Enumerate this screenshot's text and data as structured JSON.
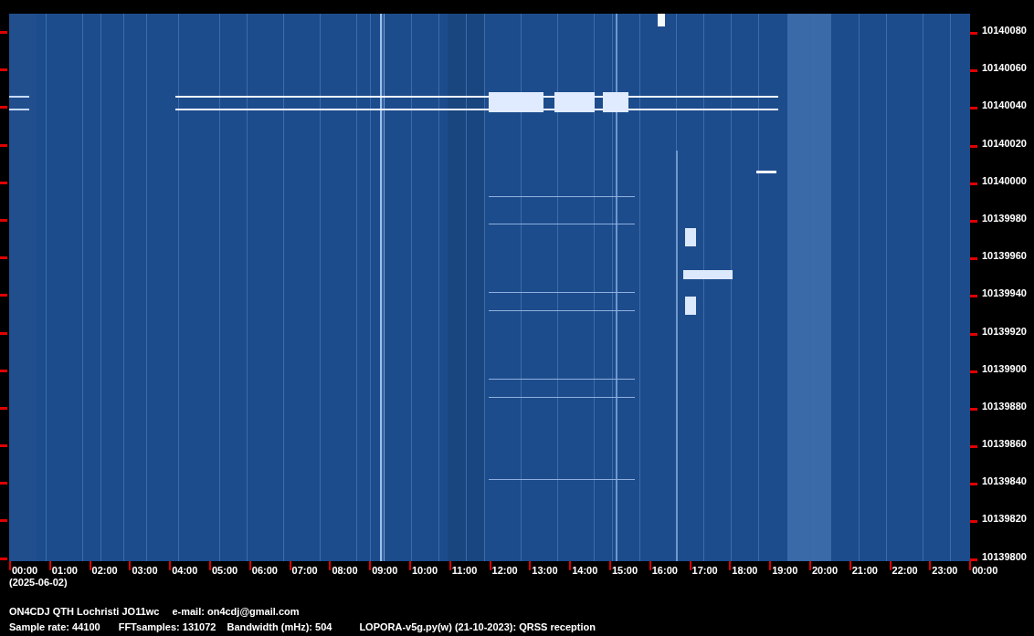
{
  "frequency_axis": {
    "labels": [
      "10140080",
      "10140060",
      "10140040",
      "10140020",
      "10140000",
      "10139980",
      "10139960",
      "10139940",
      "10139920",
      "10139900",
      "10139880",
      "10139860",
      "10139840",
      "10139820",
      "10139800"
    ]
  },
  "time_axis": {
    "labels": [
      "00:00",
      "01:00",
      "02:00",
      "03:00",
      "04:00",
      "05:00",
      "06:00",
      "07:00",
      "08:00",
      "09:00",
      "10:00",
      "11:00",
      "12:00",
      "13:00",
      "14:00",
      "15:00",
      "16:00",
      "17:00",
      "18:00",
      "19:00",
      "20:00",
      "21:00",
      "22:00",
      "23:00",
      "00:00"
    ]
  },
  "date": "(2025-06-02)",
  "station_line": {
    "station": "ON4CDJ QTH Lochristi JO11wc",
    "email": "e-mail: on4cdj@gmail.com"
  },
  "info_line": {
    "sample_rate": "Sample rate: 44100",
    "fft_samples": "FFTsamples: 131072",
    "bandwidth": "Bandwidth (mHz): 504",
    "software": "LOPORA-v5g.py(w) (21-10-2023): QRSS reception"
  }
}
